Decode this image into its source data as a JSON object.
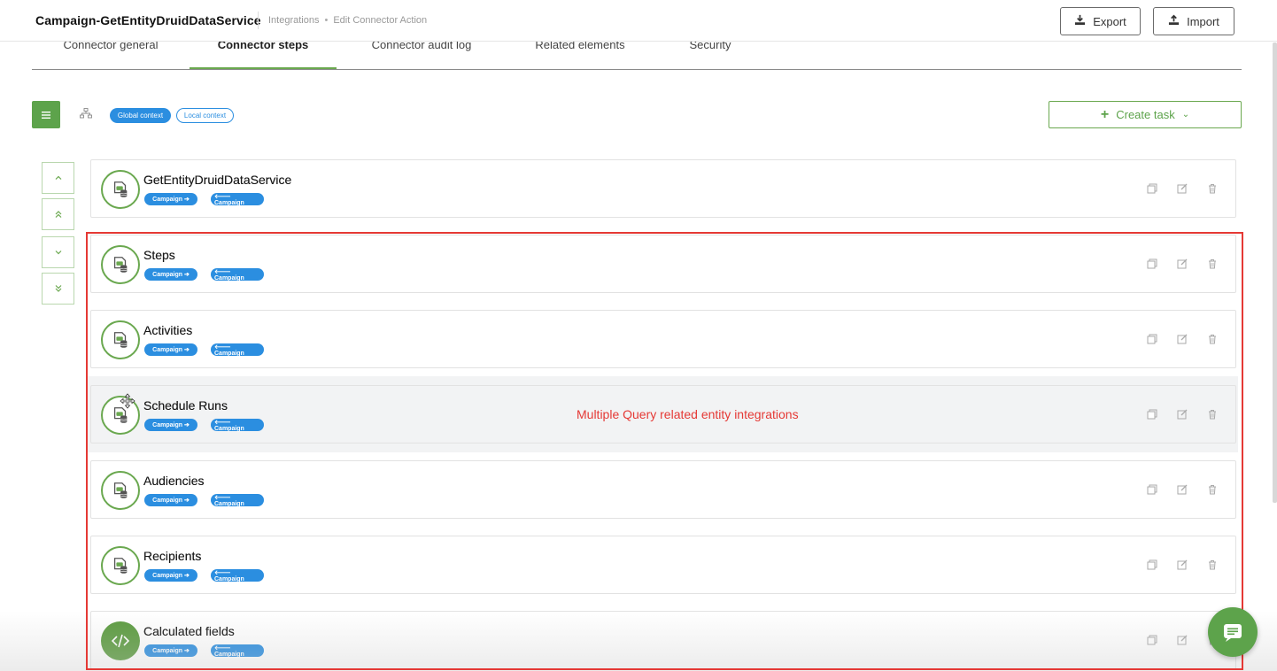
{
  "header": {
    "title": "Campaign-GetEntityDruidDataService",
    "breadcrumb": [
      "Integrations",
      "Edit Connector Action"
    ],
    "breadcrumb_separator": "•",
    "export_label": "Export",
    "import_label": "Import"
  },
  "tabs": [
    {
      "label": "Connector general",
      "active": false
    },
    {
      "label": "Connector steps",
      "active": true
    },
    {
      "label": "Connector audit log",
      "active": false
    },
    {
      "label": "Related elements",
      "active": false
    },
    {
      "label": "Security",
      "active": false
    }
  ],
  "toolbar": {
    "global_context": "Global context",
    "local_context": "Local context",
    "create_task": "Create task"
  },
  "steps": [
    {
      "name": "GetEntityDruidDataService",
      "input_tag": "Campaign ➔",
      "output_tag": "🡐 Campaign",
      "icon": "data-service-icon"
    },
    {
      "name": "Steps",
      "input_tag": "Campaign ➔",
      "output_tag": "🡐 Campaign",
      "icon": "data-service-icon"
    },
    {
      "name": "Activities",
      "input_tag": "Campaign ➔",
      "output_tag": "🡐 Campaign",
      "icon": "data-service-icon"
    },
    {
      "name": "Schedule Runs",
      "input_tag": "Campaign ➔",
      "output_tag": "🡐 Campaign",
      "icon": "data-service-icon"
    },
    {
      "name": "Audiencies",
      "input_tag": "Campaign ➔",
      "output_tag": "🡐 Campaign",
      "icon": "data-service-icon"
    },
    {
      "name": "Recipients",
      "input_tag": "Campaign ➔",
      "output_tag": "🡐 Campaign",
      "icon": "data-service-icon"
    },
    {
      "name": "Calculated fields",
      "input_tag": "Campaign ➔",
      "output_tag": "🡐 Campaign",
      "icon": "code-icon"
    }
  ],
  "annotation": "Multiple Query related entity integrations",
  "colors": {
    "brand_green": "#5da34b",
    "tag_blue": "#2b8ee0",
    "annotation_red": "#e53935"
  }
}
